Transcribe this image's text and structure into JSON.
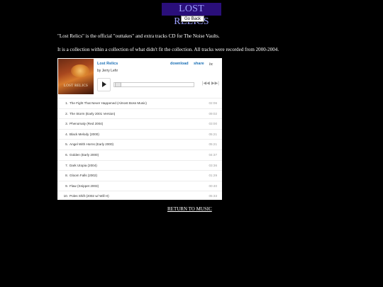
{
  "header": {
    "title": "LOST RELICS",
    "go_back": "Go Back"
  },
  "intro": {
    "line1": "\"Lost Relics\" is the official \"outtakes\" and extra tracks CD for The Noise Vaults.",
    "line2": "It is a collection within a collection of what didn't fit the collection. All tracks were recorded from 2000-2004."
  },
  "player": {
    "album_title": "Lost Relics",
    "artist": "by Jerry Lehr",
    "download": "download",
    "share": "share",
    "logo": "bc",
    "cover_text": "LOST RELICS",
    "prev": "|◀◀",
    "next": "▶▶|",
    "progress": 0,
    "tracks": [
      {
        "num": "1.",
        "name": "The Fight That Never Happened (Almost Boss Music)",
        "duration": "02:06"
      },
      {
        "num": "2.",
        "name": "The Storm (Early 2001 Version)",
        "duration": "09:02"
      },
      {
        "num": "3.",
        "name": "Phenomaly (Red 2004)",
        "duration": "03:00"
      },
      {
        "num": "4.",
        "name": "Black Melody (2000)",
        "duration": "05:21"
      },
      {
        "num": "5.",
        "name": "Angel With Horns (Early 2000)",
        "duration": "05:21"
      },
      {
        "num": "6.",
        "name": "Golden (Early 2000)",
        "duration": "04:37"
      },
      {
        "num": "7.",
        "name": "Dark Utopia (2004)",
        "duration": "03:36"
      },
      {
        "num": "8.",
        "name": "Gloom Falls (2002)",
        "duration": "01:29"
      },
      {
        "num": "9.",
        "name": "Flaw (Snippet 2003)",
        "duration": "00:40"
      },
      {
        "num": "10.",
        "name": "Poles Shift (2002 w/ Will H)",
        "duration": "05:33"
      }
    ]
  },
  "footer": {
    "return_link": "RETURN TO MUSIC"
  },
  "colors": {
    "title_bg": "#2a0f7a",
    "title_text": "#9da0ff",
    "link_blue": "#1a6fb5"
  }
}
